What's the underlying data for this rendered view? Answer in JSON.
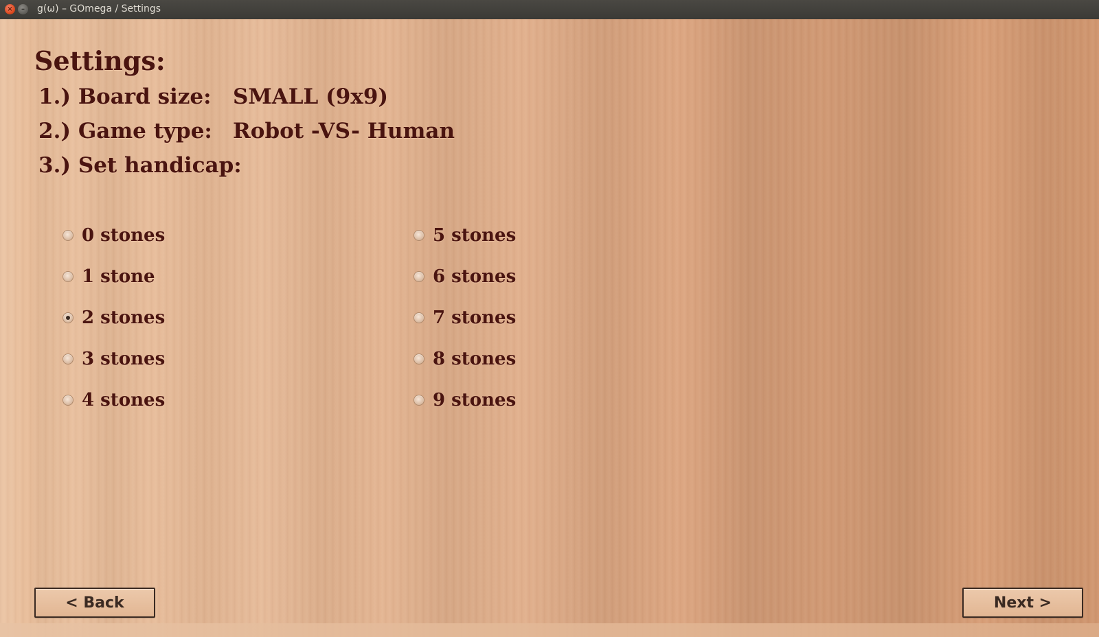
{
  "window": {
    "title": "g(ω) – GOmega / Settings"
  },
  "settings": {
    "heading": "Settings:",
    "rows": [
      {
        "label": "1.) Board size:",
        "value": "SMALL (9x9)"
      },
      {
        "label": "2.) Game type:",
        "value": "Robot -VS- Human"
      },
      {
        "label": "3.) Set handicap:",
        "value": ""
      }
    ]
  },
  "handicap": {
    "selected": "2 stones",
    "options": [
      {
        "label": "0 stones",
        "checked": false
      },
      {
        "label": "1 stone",
        "checked": false
      },
      {
        "label": "2 stones",
        "checked": true
      },
      {
        "label": "3 stones",
        "checked": false
      },
      {
        "label": "4 stones",
        "checked": false
      },
      {
        "label": "5 stones",
        "checked": false
      },
      {
        "label": "6 stones",
        "checked": false
      },
      {
        "label": "7 stones",
        "checked": false
      },
      {
        "label": "8 stones",
        "checked": false
      },
      {
        "label": "9 stones",
        "checked": false
      }
    ]
  },
  "nav": {
    "back_label": "< Back",
    "next_label": "Next >"
  }
}
